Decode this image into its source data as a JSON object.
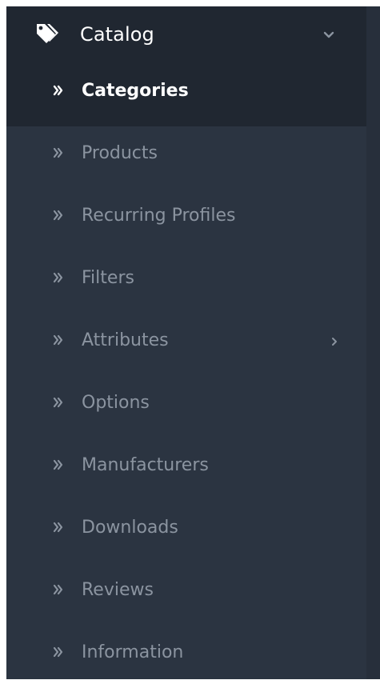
{
  "sidebar": {
    "section": {
      "label": "Catalog",
      "icon": "tags-icon",
      "expand_icon": "chevron-down-icon"
    },
    "items": [
      {
        "label": "Categories",
        "active": true,
        "submenu": false
      },
      {
        "label": "Products",
        "active": false,
        "submenu": false
      },
      {
        "label": "Recurring Profiles",
        "active": false,
        "submenu": false
      },
      {
        "label": "Filters",
        "active": false,
        "submenu": false
      },
      {
        "label": "Attributes",
        "active": false,
        "submenu": true
      },
      {
        "label": "Options",
        "active": false,
        "submenu": false
      },
      {
        "label": "Manufacturers",
        "active": false,
        "submenu": false
      },
      {
        "label": "Downloads",
        "active": false,
        "submenu": false
      },
      {
        "label": "Reviews",
        "active": false,
        "submenu": false
      },
      {
        "label": "Information",
        "active": false,
        "submenu": false
      }
    ],
    "colors": {
      "background": "#2b3441",
      "header_background": "#202731",
      "active_text": "#ffffff",
      "inactive_text": "#8b94a0"
    }
  }
}
